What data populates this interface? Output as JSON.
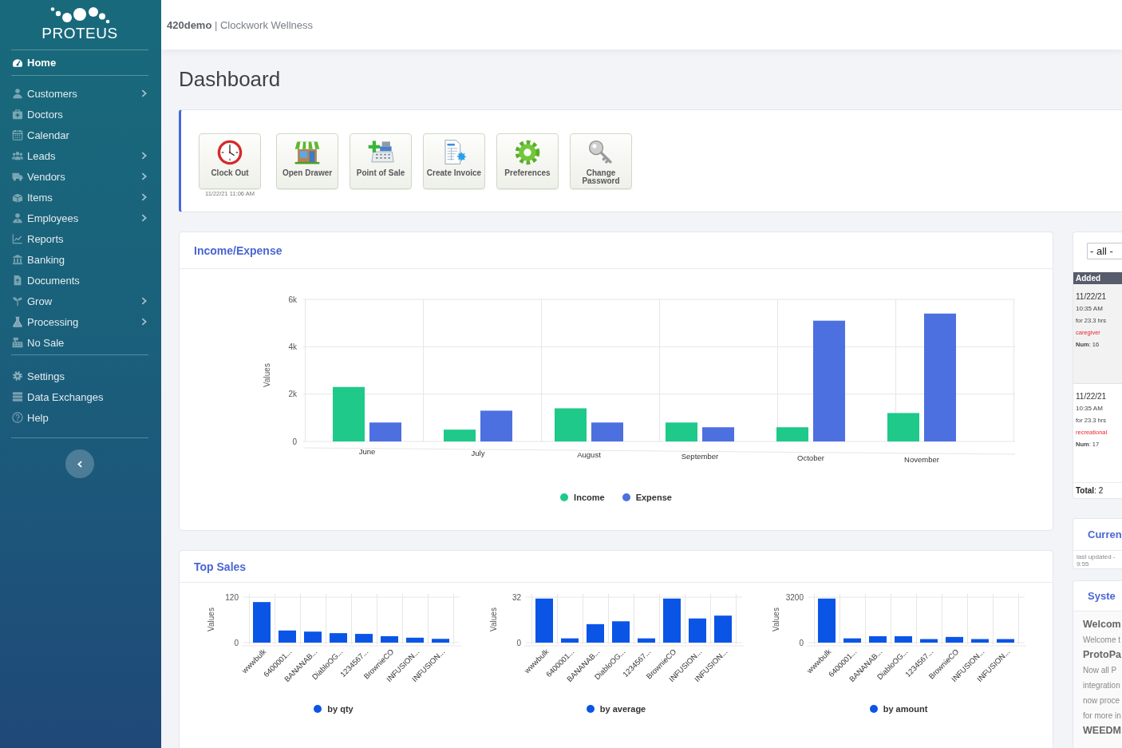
{
  "header": {
    "title": "**420demo** | Clockwork Wellness"
  },
  "sidebar": {
    "logo": {
      "text": "PROTEUS"
    },
    "groups": [
      {
        "items": [
          {
            "label": "Home",
            "selected": true,
            "has_submenu": false
          }
        ]
      },
      {
        "items": [
          {
            "label": "Customers",
            "selected": false,
            "has_submenu": true
          },
          {
            "label": "Doctors",
            "selected": false,
            "has_submenu": false
          },
          {
            "label": "Calendar",
            "selected": false,
            "has_submenu": false
          },
          {
            "label": "Leads",
            "selected": false,
            "has_submenu": true
          },
          {
            "label": "Vendors",
            "selected": false,
            "has_submenu": true
          },
          {
            "label": "Items",
            "selected": false,
            "has_submenu": true
          },
          {
            "label": "Employees",
            "selected": false,
            "has_submenu": true
          },
          {
            "label": "Reports",
            "selected": false,
            "has_submenu": false
          },
          {
            "label": "Banking",
            "selected": false,
            "has_submenu": false
          },
          {
            "label": "Documents",
            "selected": false,
            "has_submenu": false
          },
          {
            "label": "Grow",
            "selected": false,
            "has_submenu": true
          },
          {
            "label": "Processing",
            "selected": false,
            "has_submenu": true
          },
          {
            "label": "No Sale",
            "selected": false,
            "has_submenu": false
          }
        ]
      },
      {
        "items": [
          {
            "label": "Settings",
            "selected": false,
            "has_submenu": false
          },
          {
            "label": "Data Exchanges",
            "selected": false,
            "has_submenu": false
          },
          {
            "label": "Help",
            "selected": false,
            "has_submenu": false
          }
        ]
      }
    ]
  },
  "page": {
    "title": "Dashboard"
  },
  "quick_actions": [
    {
      "label": "Clock Out",
      "timestamp": "11/22/21 11:06 AM"
    },
    {
      "label": "Open Drawer"
    },
    {
      "label": "Point of Sale"
    },
    {
      "label": "Create Invoice"
    },
    {
      "label": "Preferences"
    },
    {
      "label": "Change Password"
    }
  ],
  "income_expense": {
    "title": "Income/Expense",
    "chart_data": {
      "type": "bar",
      "ylabel": "Values",
      "categories": [
        "June",
        "July",
        "August",
        "September",
        "October",
        "November"
      ],
      "series": [
        {
          "name": "Income",
          "color": "#1ec98a",
          "values": [
            2300,
            500,
            1400,
            800,
            600,
            1200
          ]
        },
        {
          "name": "Expense",
          "color": "#4d70e0",
          "values": [
            800,
            1300,
            800,
            600,
            5100,
            5400
          ]
        }
      ],
      "ylim": [
        0,
        6000
      ],
      "yticks": [
        0,
        {
          "value": 2000,
          "label": "2k"
        },
        {
          "value": 4000,
          "label": "4k"
        },
        {
          "value": 6000,
          "label": "6k"
        }
      ],
      "legend": "bottom"
    }
  },
  "top_sales": {
    "title": "Top Sales",
    "charts": [
      {
        "chart_data": {
          "type": "bar",
          "ylabel": "Values",
          "categories": [
            "wwwbulk",
            "6400001...",
            "BANANAB...",
            "DiabloOG...",
            "1234567...",
            "BrownieCO",
            "INFUSION...",
            "INFUSION..."
          ],
          "series": [
            {
              "name": "by qty",
              "color": "#0b55e6",
              "values": [
                107,
                32,
                29,
                25,
                23,
                17,
                13,
                10
              ]
            }
          ],
          "ylim": [
            0,
            120
          ],
          "yticks": [
            0,
            120
          ],
          "legend": "bottom"
        }
      },
      {
        "chart_data": {
          "type": "bar",
          "ylabel": "Values",
          "categories": [
            "wwwbulk",
            "6400001...",
            "BANANAB...",
            "DiabloOG...",
            "1234567...",
            "BrownieCO",
            "INFUSION...",
            "INFUSION..."
          ],
          "series": [
            {
              "name": "by average",
              "color": "#0b55e6",
              "values": [
                31,
                3,
                13,
                15,
                3,
                31,
                17,
                19
              ]
            }
          ],
          "ylim": [
            0,
            32
          ],
          "yticks": [
            0,
            32
          ],
          "legend": "bottom"
        }
      },
      {
        "chart_data": {
          "type": "bar",
          "ylabel": "Values",
          "categories": [
            "wwwbulk",
            "6400001...",
            "BANANAB...",
            "DiabloOG...",
            "1234567...",
            "BrownieCO",
            "INFUSION...",
            "INFUSION..."
          ],
          "series": [
            {
              "name": "by amount",
              "color": "#0b55e6",
              "values": [
                3100,
                300,
                450,
                450,
                250,
                400,
                250,
                250
              ]
            }
          ],
          "ylim": [
            0,
            3200
          ],
          "yticks": [
            0,
            3200
          ],
          "legend": "bottom"
        }
      }
    ]
  },
  "right_column": {
    "list_panel": {
      "filter": {
        "value": "- all -"
      },
      "column": "Added",
      "rows": [
        {
          "date": "11/22/21",
          "time": "10:35 AM",
          "duration": "for 23.3 hrs",
          "type": "caregiver",
          "num": "**Num**: 16"
        },
        {
          "date": "11/22/21",
          "time": "10:35 AM",
          "duration": "for 23.3 hrs",
          "type": "recreational",
          "num": "**Num**: 17"
        }
      ],
      "total": "**Total**: 2"
    },
    "panels": [
      {
        "title": "Curren",
        "note": "last updated - 9:55"
      },
      {
        "title": "Syste",
        "lines": [
          {
            "kind": "heading",
            "text": "Welcom"
          },
          {
            "kind": "text",
            "text": "Welcome t"
          },
          {
            "kind": "heading",
            "text": "ProtoPa"
          },
          {
            "kind": "text",
            "text": "Now all P"
          },
          {
            "kind": "text",
            "text": "integration"
          },
          {
            "kind": "text",
            "text": "now proce"
          },
          {
            "kind": "text",
            "text": "for more in"
          },
          {
            "kind": "heading",
            "text": "WEEDM"
          }
        ]
      }
    ]
  }
}
